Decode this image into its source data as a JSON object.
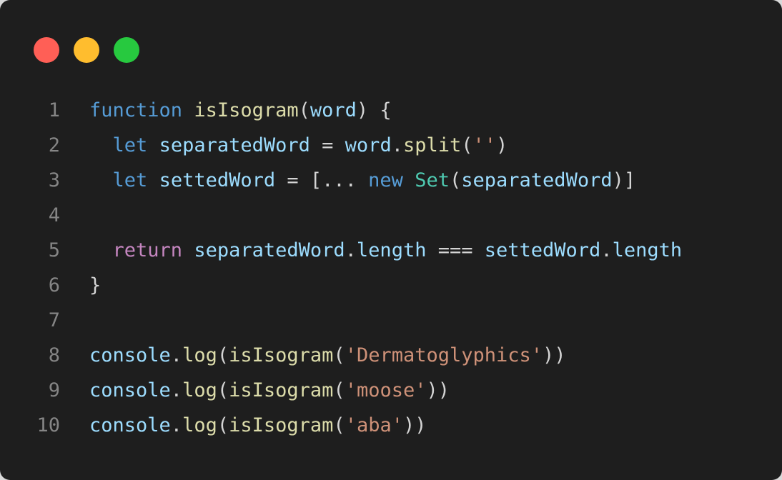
{
  "window": {
    "controls": [
      {
        "name": "close",
        "color": "#ff5f56"
      },
      {
        "name": "minimize",
        "color": "#ffbd2e"
      },
      {
        "name": "maximize",
        "color": "#27c93f"
      }
    ]
  },
  "editor": {
    "lines": [
      {
        "number": "1",
        "tokens": [
          {
            "t": "kw",
            "v": "function"
          },
          {
            "t": "punc",
            "v": " "
          },
          {
            "t": "fn",
            "v": "isIsogram"
          },
          {
            "t": "punc",
            "v": "("
          },
          {
            "t": "var",
            "v": "word"
          },
          {
            "t": "punc",
            "v": ") {"
          }
        ]
      },
      {
        "number": "2",
        "tokens": [
          {
            "t": "punc",
            "v": "  "
          },
          {
            "t": "kw",
            "v": "let"
          },
          {
            "t": "punc",
            "v": " "
          },
          {
            "t": "var",
            "v": "separatedWord"
          },
          {
            "t": "punc",
            "v": " = "
          },
          {
            "t": "var",
            "v": "word"
          },
          {
            "t": "punc",
            "v": "."
          },
          {
            "t": "fn",
            "v": "split"
          },
          {
            "t": "punc",
            "v": "("
          },
          {
            "t": "str",
            "v": "''"
          },
          {
            "t": "punc",
            "v": ")"
          }
        ]
      },
      {
        "number": "3",
        "tokens": [
          {
            "t": "punc",
            "v": "  "
          },
          {
            "t": "kw",
            "v": "let"
          },
          {
            "t": "punc",
            "v": " "
          },
          {
            "t": "var",
            "v": "settedWord"
          },
          {
            "t": "punc",
            "v": " = [... "
          },
          {
            "t": "kw",
            "v": "new"
          },
          {
            "t": "punc",
            "v": " "
          },
          {
            "t": "cls",
            "v": "Set"
          },
          {
            "t": "punc",
            "v": "("
          },
          {
            "t": "var",
            "v": "separatedWord"
          },
          {
            "t": "punc",
            "v": ")]"
          }
        ]
      },
      {
        "number": "4",
        "tokens": []
      },
      {
        "number": "5",
        "tokens": [
          {
            "t": "punc",
            "v": "  "
          },
          {
            "t": "ctl",
            "v": "return"
          },
          {
            "t": "punc",
            "v": " "
          },
          {
            "t": "var",
            "v": "separatedWord"
          },
          {
            "t": "punc",
            "v": "."
          },
          {
            "t": "var",
            "v": "length"
          },
          {
            "t": "punc",
            "v": " === "
          },
          {
            "t": "var",
            "v": "settedWord"
          },
          {
            "t": "punc",
            "v": "."
          },
          {
            "t": "var",
            "v": "length"
          }
        ]
      },
      {
        "number": "6",
        "tokens": [
          {
            "t": "punc",
            "v": "}"
          }
        ]
      },
      {
        "number": "7",
        "tokens": []
      },
      {
        "number": "8",
        "tokens": [
          {
            "t": "var",
            "v": "console"
          },
          {
            "t": "punc",
            "v": "."
          },
          {
            "t": "fn",
            "v": "log"
          },
          {
            "t": "punc",
            "v": "("
          },
          {
            "t": "fn",
            "v": "isIsogram"
          },
          {
            "t": "punc",
            "v": "("
          },
          {
            "t": "str",
            "v": "'Dermatoglyphics'"
          },
          {
            "t": "punc",
            "v": "))"
          }
        ]
      },
      {
        "number": "9",
        "tokens": [
          {
            "t": "var",
            "v": "console"
          },
          {
            "t": "punc",
            "v": "."
          },
          {
            "t": "fn",
            "v": "log"
          },
          {
            "t": "punc",
            "v": "("
          },
          {
            "t": "fn",
            "v": "isIsogram"
          },
          {
            "t": "punc",
            "v": "("
          },
          {
            "t": "str",
            "v": "'moose'"
          },
          {
            "t": "punc",
            "v": "))"
          }
        ]
      },
      {
        "number": "10",
        "tokens": [
          {
            "t": "var",
            "v": "console"
          },
          {
            "t": "punc",
            "v": "."
          },
          {
            "t": "fn",
            "v": "log"
          },
          {
            "t": "punc",
            "v": "("
          },
          {
            "t": "fn",
            "v": "isIsogram"
          },
          {
            "t": "punc",
            "v": "("
          },
          {
            "t": "str",
            "v": "'aba'"
          },
          {
            "t": "punc",
            "v": "))"
          }
        ]
      }
    ]
  }
}
